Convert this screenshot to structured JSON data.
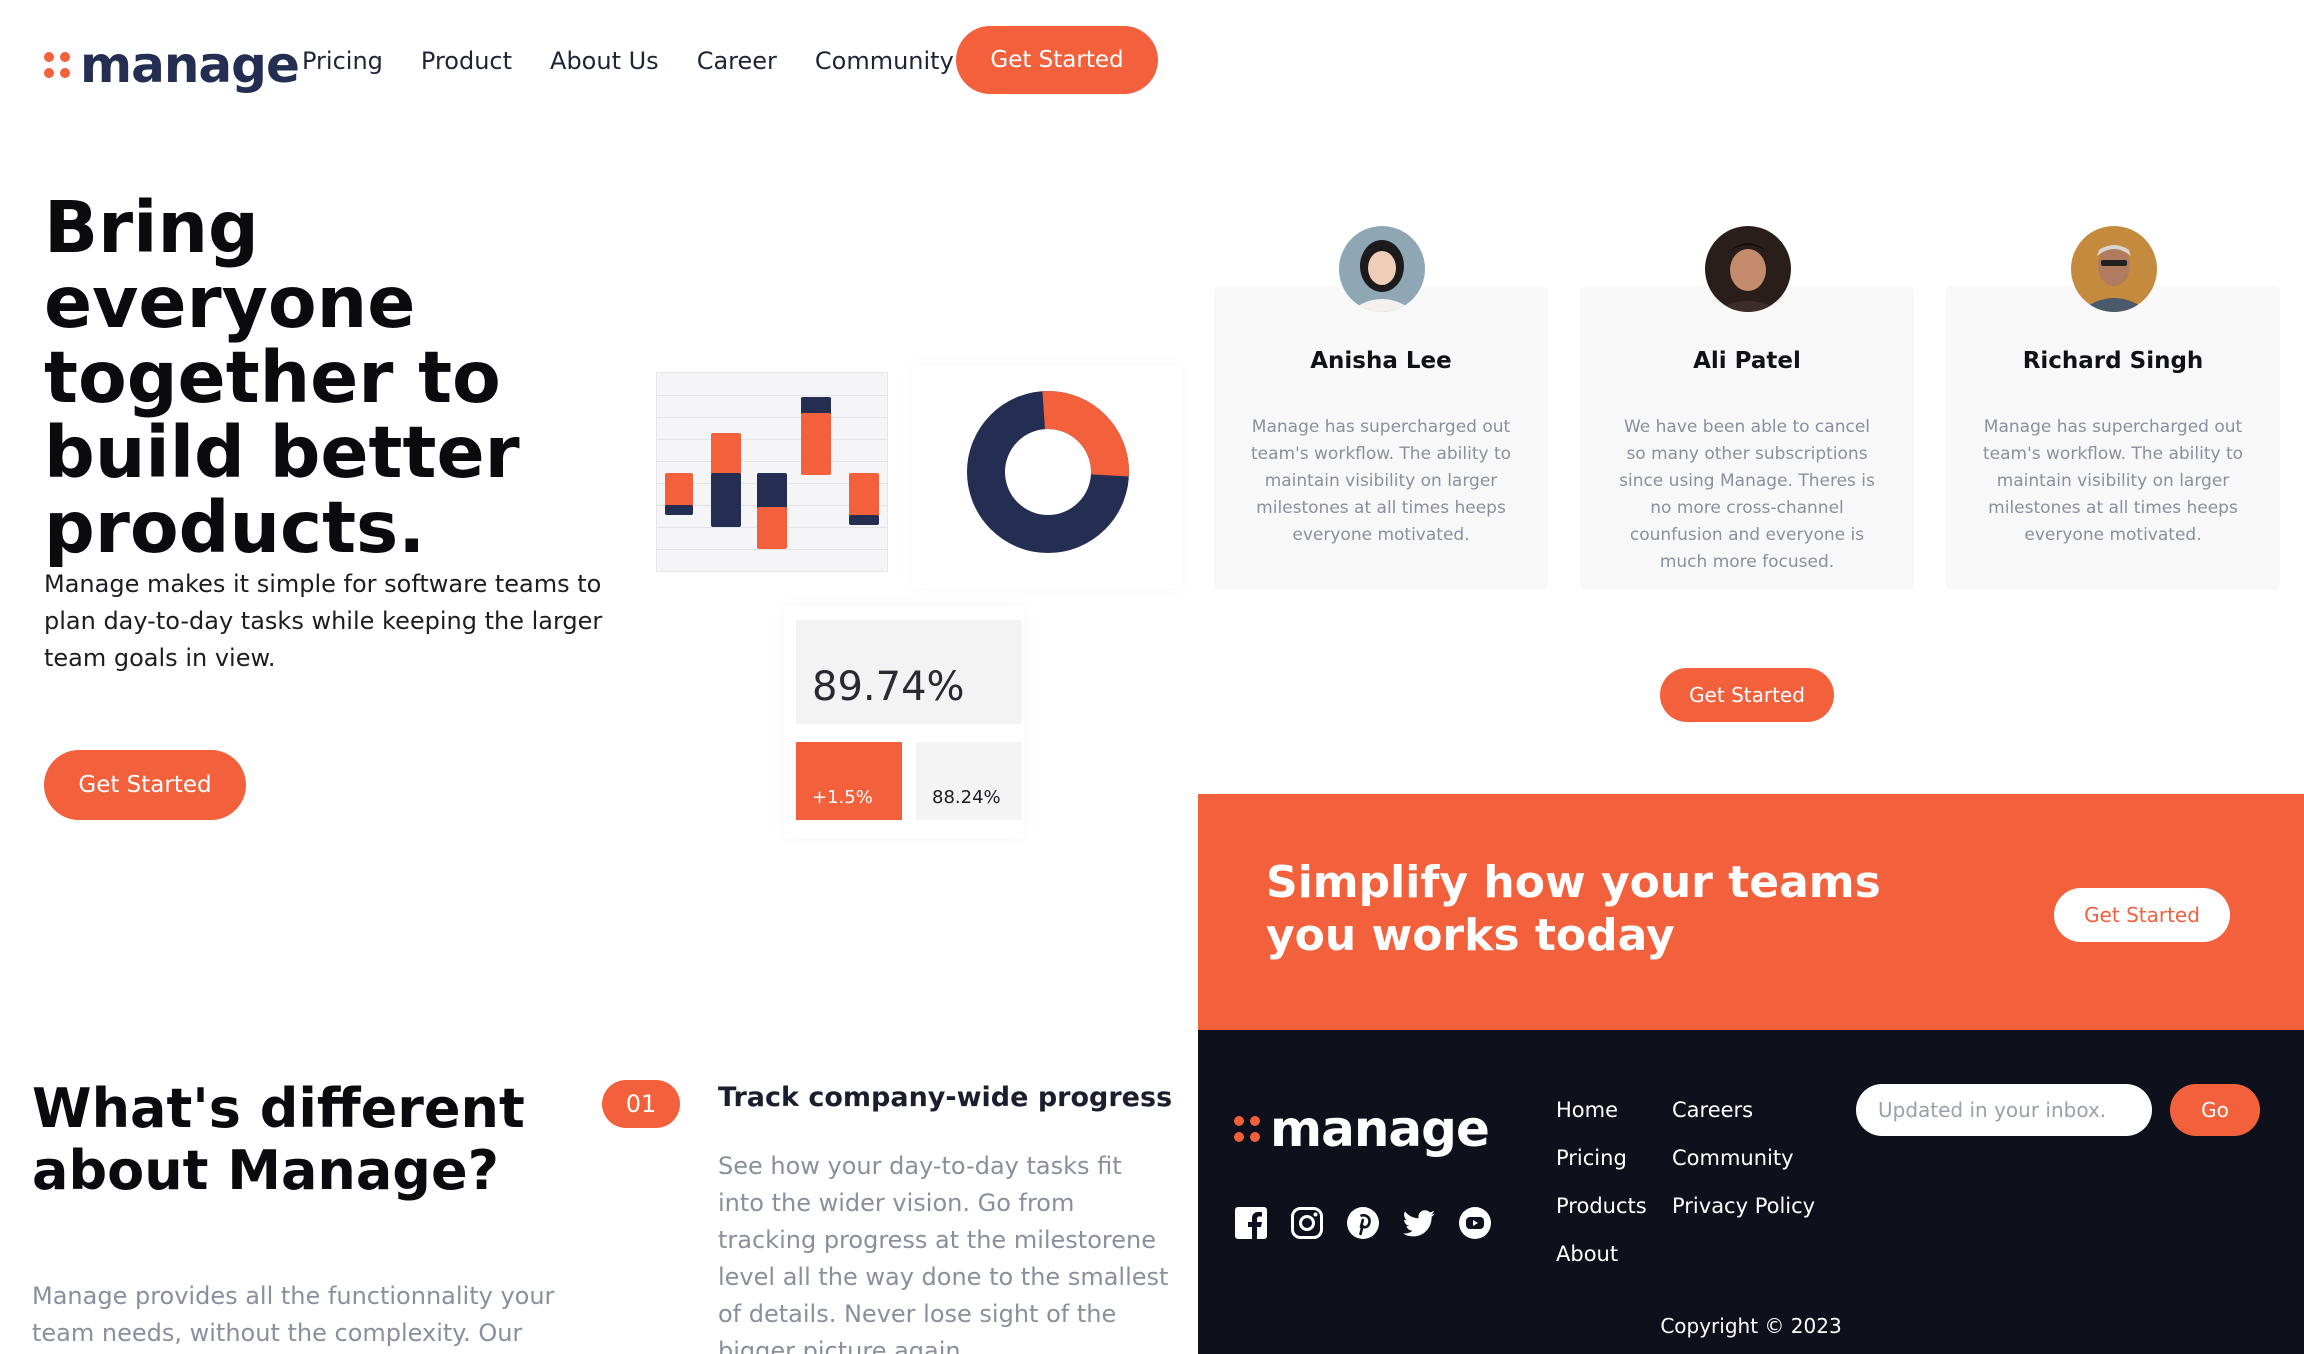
{
  "brand": {
    "name": "manage",
    "accent": "#f2603c",
    "dark": "#242d52"
  },
  "nav": {
    "items": [
      "Pricing",
      "Product",
      "About Us",
      "Career",
      "Community"
    ],
    "cta": "Get Started"
  },
  "hero": {
    "title": "Bring everyone together to build better products.",
    "subtitle": "Manage makes it simple for software teams to plan day-to-day tasks while keeping the larger team goals in view.",
    "cta": "Get Started"
  },
  "stats": {
    "main": "89.74%",
    "change": "+1.5%",
    "secondary": "88.24%"
  },
  "donut": {
    "segments": [
      {
        "value": 0.27,
        "color": "#f2603c"
      },
      {
        "value": 0.73,
        "color": "#242d52"
      }
    ]
  },
  "different": {
    "title": "What's different about Manage?",
    "text": "Manage provides all the functionnality your team needs, without the complexity. Our software is",
    "step": {
      "number": "01",
      "title": "Track company-wide progress",
      "text": "See how your day-to-day tasks fit into the wider vision. Go from tracking progress at the milestorene level all the way done to the smallest of details. Never lose sight of the bigger picture again."
    }
  },
  "testimonials": [
    {
      "name": "Anisha Lee",
      "quote": "Manage has supercharged out team's workflow. The ability to maintain visibility on larger milestones at all times heeps everyone motivated."
    },
    {
      "name": "Ali Patel",
      "quote": "We have been able to cancel so many other subscriptions since using Manage. Theres is no more cross-channel counfusion and everyone is much more focused."
    },
    {
      "name": "Richard Singh",
      "quote": "Manage has supercharged out team's workflow. The ability to maintain visibility on larger milestones at all times heeps everyone motivated."
    }
  ],
  "testimonials_cta": "Get Started",
  "band": {
    "title": "Simplify how your teams you works today",
    "cta": "Get Started"
  },
  "footer": {
    "links_col1": [
      "Home",
      "Pricing",
      "Products",
      "About"
    ],
    "links_col2": [
      "Careers",
      "Community",
      "Privacy Policy"
    ],
    "socials": [
      "facebook-icon",
      "instagram-icon",
      "pinterest-icon",
      "twitter-icon",
      "youtube-icon"
    ],
    "input_placeholder": "Updated in your inbox.",
    "go": "Go",
    "copyright": "Copyright © 2023"
  }
}
